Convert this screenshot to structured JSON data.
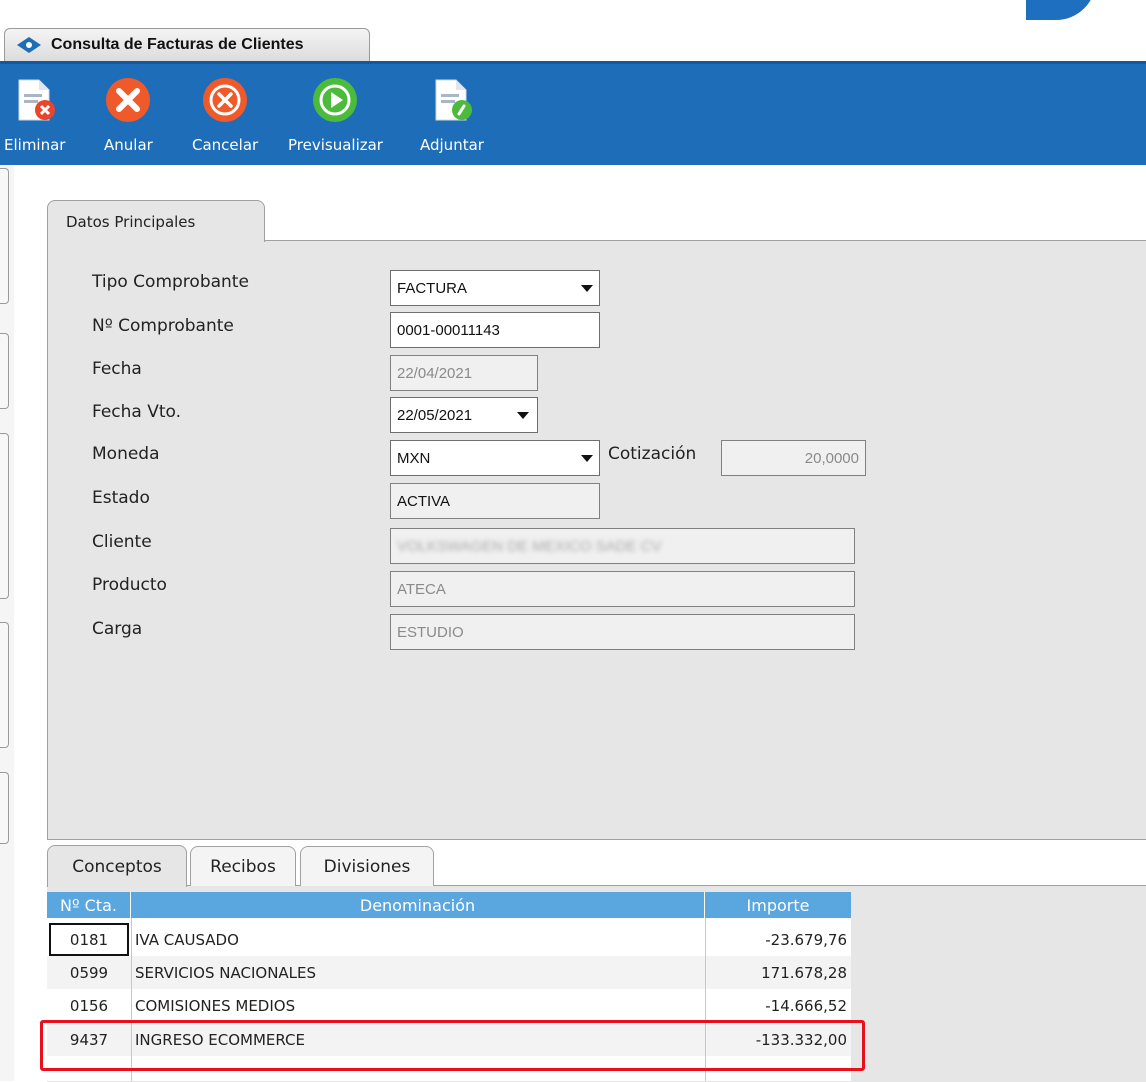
{
  "window": {
    "tab_title": "Consulta de Facturas de Clientes"
  },
  "toolbar": {
    "buttons": [
      {
        "label": "Eliminar",
        "icon": "delete-document-icon"
      },
      {
        "label": "Anular",
        "icon": "x-circle-icon"
      },
      {
        "label": "Cancelar",
        "icon": "cancel-circle-icon"
      },
      {
        "label": "Previsualizar",
        "icon": "play-circle-icon"
      },
      {
        "label": "Adjuntar",
        "icon": "attach-document-icon"
      }
    ]
  },
  "main_tab": {
    "label": "Datos Principales"
  },
  "form": {
    "tipo_comprobante": {
      "label": "Tipo Comprobante",
      "value": "FACTURA"
    },
    "nro_comprobante": {
      "label": "Nº Comprobante",
      "value": "0001-00011143"
    },
    "fecha": {
      "label": "Fecha",
      "value": "22/04/2021"
    },
    "fecha_vto": {
      "label": "Fecha Vto.",
      "value": "22/05/2021"
    },
    "moneda": {
      "label": "Moneda",
      "value": "MXN"
    },
    "cotizacion": {
      "label": "Cotización",
      "value": "20,0000"
    },
    "estado": {
      "label": "Estado",
      "value": "ACTIVA"
    },
    "cliente": {
      "label": "Cliente",
      "value": "VOLKSWAGEN DE MEXICO SADE CV"
    },
    "producto": {
      "label": "Producto",
      "value": "ATECA"
    },
    "carga": {
      "label": "Carga",
      "value": "ESTUDIO"
    }
  },
  "bottom_tabs": [
    "Conceptos",
    "Recibos",
    "Divisiones"
  ],
  "grid": {
    "headers": [
      "Nº Cta.",
      "Denominación",
      "Importe"
    ],
    "rows": [
      {
        "cta": "0181",
        "denominacion": "IVA CAUSADO",
        "importe": "-23.679,76"
      },
      {
        "cta": "0599",
        "denominacion": "SERVICIOS NACIONALES",
        "importe": "171.678,28"
      },
      {
        "cta": "0156",
        "denominacion": "COMISIONES MEDIOS",
        "importe": "-14.666,52"
      },
      {
        "cta": "9437",
        "denominacion": "INGRESO ECOMMERCE",
        "importe": "-133.332,00"
      }
    ]
  },
  "colors": {
    "toolbar_blue": "#1d6db8",
    "grid_header_blue": "#5aa6df",
    "highlight_red": "#e8101a",
    "panel_gray": "#e6e6e6"
  }
}
